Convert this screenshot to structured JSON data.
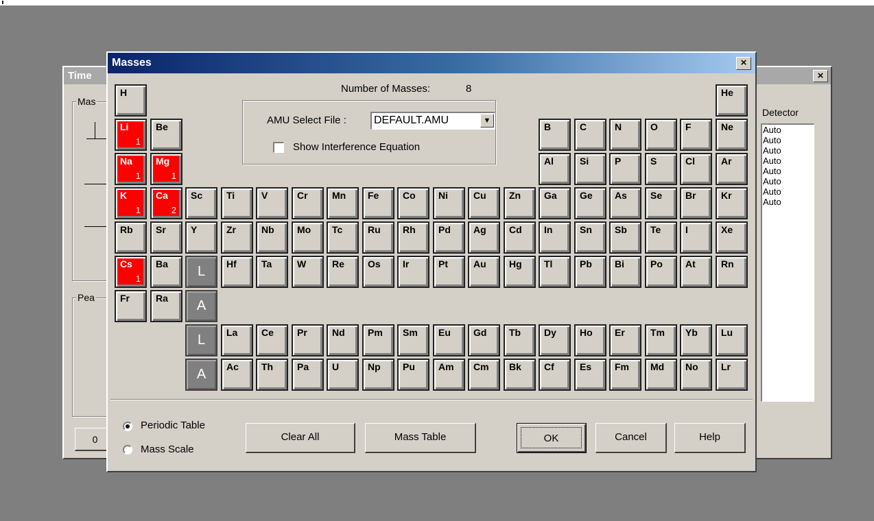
{
  "background_window": {
    "title": "Time",
    "group_label_1": "Mas",
    "group_label_2": "Pea",
    "detector_header": "Detector",
    "detectors": [
      "Auto",
      "Auto",
      "Auto",
      "Auto",
      "Auto",
      "Auto",
      "Auto",
      "Auto"
    ],
    "bottom_button": "0",
    "close_glyph": "×"
  },
  "dialog": {
    "title": "Masses",
    "close_glyph": "×",
    "masses_label": "Number of Masses:",
    "masses_count": "8",
    "amu_label": "AMU Select File :",
    "amu_value": "DEFAULT.AMU",
    "dropdown_arrow": "▼",
    "interference_label": "Show Interference Equation",
    "interference_checked": false
  },
  "elements": [
    {
      "symbol": "H",
      "selected": false,
      "count": ""
    },
    {
      "symbol": "He",
      "selected": false,
      "count": ""
    },
    {
      "symbol": "Li",
      "selected": true,
      "count": "1"
    },
    {
      "symbol": "Be",
      "selected": false,
      "count": ""
    },
    {
      "symbol": "B",
      "selected": false,
      "count": ""
    },
    {
      "symbol": "C",
      "selected": false,
      "count": ""
    },
    {
      "symbol": "N",
      "selected": false,
      "count": ""
    },
    {
      "symbol": "O",
      "selected": false,
      "count": ""
    },
    {
      "symbol": "F",
      "selected": false,
      "count": ""
    },
    {
      "symbol": "Ne",
      "selected": false,
      "count": ""
    },
    {
      "symbol": "Na",
      "selected": true,
      "count": "1"
    },
    {
      "symbol": "Mg",
      "selected": true,
      "count": "1"
    },
    {
      "symbol": "Al",
      "selected": false,
      "count": ""
    },
    {
      "symbol": "Si",
      "selected": false,
      "count": ""
    },
    {
      "symbol": "P",
      "selected": false,
      "count": ""
    },
    {
      "symbol": "S",
      "selected": false,
      "count": ""
    },
    {
      "symbol": "Cl",
      "selected": false,
      "count": ""
    },
    {
      "symbol": "Ar",
      "selected": false,
      "count": ""
    },
    {
      "symbol": "K",
      "selected": true,
      "count": "1"
    },
    {
      "symbol": "Ca",
      "selected": true,
      "count": "2"
    },
    {
      "symbol": "Sc",
      "selected": false,
      "count": ""
    },
    {
      "symbol": "Ti",
      "selected": false,
      "count": ""
    },
    {
      "symbol": "V",
      "selected": false,
      "count": ""
    },
    {
      "symbol": "Cr",
      "selected": false,
      "count": ""
    },
    {
      "symbol": "Mn",
      "selected": false,
      "count": ""
    },
    {
      "symbol": "Fe",
      "selected": false,
      "count": ""
    },
    {
      "symbol": "Co",
      "selected": false,
      "count": ""
    },
    {
      "symbol": "Ni",
      "selected": false,
      "count": ""
    },
    {
      "symbol": "Cu",
      "selected": false,
      "count": ""
    },
    {
      "symbol": "Zn",
      "selected": false,
      "count": ""
    },
    {
      "symbol": "Ga",
      "selected": false,
      "count": ""
    },
    {
      "symbol": "Ge",
      "selected": false,
      "count": ""
    },
    {
      "symbol": "As",
      "selected": false,
      "count": ""
    },
    {
      "symbol": "Se",
      "selected": false,
      "count": ""
    },
    {
      "symbol": "Br",
      "selected": false,
      "count": ""
    },
    {
      "symbol": "Kr",
      "selected": false,
      "count": ""
    },
    {
      "symbol": "Rb",
      "selected": false,
      "count": ""
    },
    {
      "symbol": "Sr",
      "selected": false,
      "count": ""
    },
    {
      "symbol": "Y",
      "selected": false,
      "count": ""
    },
    {
      "symbol": "Zr",
      "selected": false,
      "count": ""
    },
    {
      "symbol": "Nb",
      "selected": false,
      "count": ""
    },
    {
      "symbol": "Mo",
      "selected": false,
      "count": ""
    },
    {
      "symbol": "Tc",
      "selected": false,
      "count": ""
    },
    {
      "symbol": "Ru",
      "selected": false,
      "count": ""
    },
    {
      "symbol": "Rh",
      "selected": false,
      "count": ""
    },
    {
      "symbol": "Pd",
      "selected": false,
      "count": ""
    },
    {
      "symbol": "Ag",
      "selected": false,
      "count": ""
    },
    {
      "symbol": "Cd",
      "selected": false,
      "count": ""
    },
    {
      "symbol": "In",
      "selected": false,
      "count": ""
    },
    {
      "symbol": "Sn",
      "selected": false,
      "count": ""
    },
    {
      "symbol": "Sb",
      "selected": false,
      "count": ""
    },
    {
      "symbol": "Te",
      "selected": false,
      "count": ""
    },
    {
      "symbol": "I",
      "selected": false,
      "count": ""
    },
    {
      "symbol": "Xe",
      "selected": false,
      "count": ""
    },
    {
      "symbol": "Cs",
      "selected": true,
      "count": "1"
    },
    {
      "symbol": "Ba",
      "selected": false,
      "count": ""
    },
    {
      "symbol": "L",
      "selected": false,
      "count": "",
      "lanact": true
    },
    {
      "symbol": "Hf",
      "selected": false,
      "count": ""
    },
    {
      "symbol": "Ta",
      "selected": false,
      "count": ""
    },
    {
      "symbol": "W",
      "selected": false,
      "count": ""
    },
    {
      "symbol": "Re",
      "selected": false,
      "count": ""
    },
    {
      "symbol": "Os",
      "selected": false,
      "count": ""
    },
    {
      "symbol": "Ir",
      "selected": false,
      "count": ""
    },
    {
      "symbol": "Pt",
      "selected": false,
      "count": ""
    },
    {
      "symbol": "Au",
      "selected": false,
      "count": ""
    },
    {
      "symbol": "Hg",
      "selected": false,
      "count": ""
    },
    {
      "symbol": "Tl",
      "selected": false,
      "count": ""
    },
    {
      "symbol": "Pb",
      "selected": false,
      "count": ""
    },
    {
      "symbol": "Bi",
      "selected": false,
      "count": ""
    },
    {
      "symbol": "Po",
      "selected": false,
      "count": ""
    },
    {
      "symbol": "At",
      "selected": false,
      "count": ""
    },
    {
      "symbol": "Rn",
      "selected": false,
      "count": ""
    },
    {
      "symbol": "Fr",
      "selected": false,
      "count": ""
    },
    {
      "symbol": "Ra",
      "selected": false,
      "count": ""
    },
    {
      "symbol": "A",
      "selected": false,
      "count": "",
      "lanact": true
    },
    {
      "symbol": "L",
      "selected": false,
      "count": "",
      "lanact": true
    },
    {
      "symbol": "La",
      "selected": false,
      "count": ""
    },
    {
      "symbol": "Ce",
      "selected": false,
      "count": ""
    },
    {
      "symbol": "Pr",
      "selected": false,
      "count": ""
    },
    {
      "symbol": "Nd",
      "selected": false,
      "count": ""
    },
    {
      "symbol": "Pm",
      "selected": false,
      "count": ""
    },
    {
      "symbol": "Sm",
      "selected": false,
      "count": ""
    },
    {
      "symbol": "Eu",
      "selected": false,
      "count": ""
    },
    {
      "symbol": "Gd",
      "selected": false,
      "count": ""
    },
    {
      "symbol": "Tb",
      "selected": false,
      "count": ""
    },
    {
      "symbol": "Dy",
      "selected": false,
      "count": ""
    },
    {
      "symbol": "Ho",
      "selected": false,
      "count": ""
    },
    {
      "symbol": "Er",
      "selected": false,
      "count": ""
    },
    {
      "symbol": "Tm",
      "selected": false,
      "count": ""
    },
    {
      "symbol": "Yb",
      "selected": false,
      "count": ""
    },
    {
      "symbol": "Lu",
      "selected": false,
      "count": ""
    },
    {
      "symbol": "A",
      "selected": false,
      "count": "",
      "lanact": true
    },
    {
      "symbol": "Ac",
      "selected": false,
      "count": ""
    },
    {
      "symbol": "Th",
      "selected": false,
      "count": ""
    },
    {
      "symbol": "Pa",
      "selected": false,
      "count": ""
    },
    {
      "symbol": "U",
      "selected": false,
      "count": ""
    },
    {
      "symbol": "Np",
      "selected": false,
      "count": ""
    },
    {
      "symbol": "Pu",
      "selected": false,
      "count": ""
    },
    {
      "symbol": "Am",
      "selected": false,
      "count": ""
    },
    {
      "symbol": "Cm",
      "selected": false,
      "count": ""
    },
    {
      "symbol": "Bk",
      "selected": false,
      "count": ""
    },
    {
      "symbol": "Cf",
      "selected": false,
      "count": ""
    },
    {
      "symbol": "Es",
      "selected": false,
      "count": ""
    },
    {
      "symbol": "Fm",
      "selected": false,
      "count": ""
    },
    {
      "symbol": "Md",
      "selected": false,
      "count": ""
    },
    {
      "symbol": "No",
      "selected": false,
      "count": ""
    },
    {
      "symbol": "Lr",
      "selected": false,
      "count": ""
    }
  ],
  "view_mode": {
    "options": [
      "Periodic Table",
      "Mass Scale"
    ],
    "selected": "Periodic Table"
  },
  "buttons": {
    "clear_all": "Clear All",
    "mass_table": "Mass Table",
    "ok": "OK",
    "cancel": "Cancel",
    "help": "Help"
  },
  "colors": {
    "selected_element": "#ff0000",
    "lanthanide_actinide_key": "#808080",
    "title_gradient_start": "#0a246a",
    "title_gradient_end": "#a6caf0",
    "dialog_face": "#d4d0c8",
    "desktop": "#7f7f7f"
  }
}
